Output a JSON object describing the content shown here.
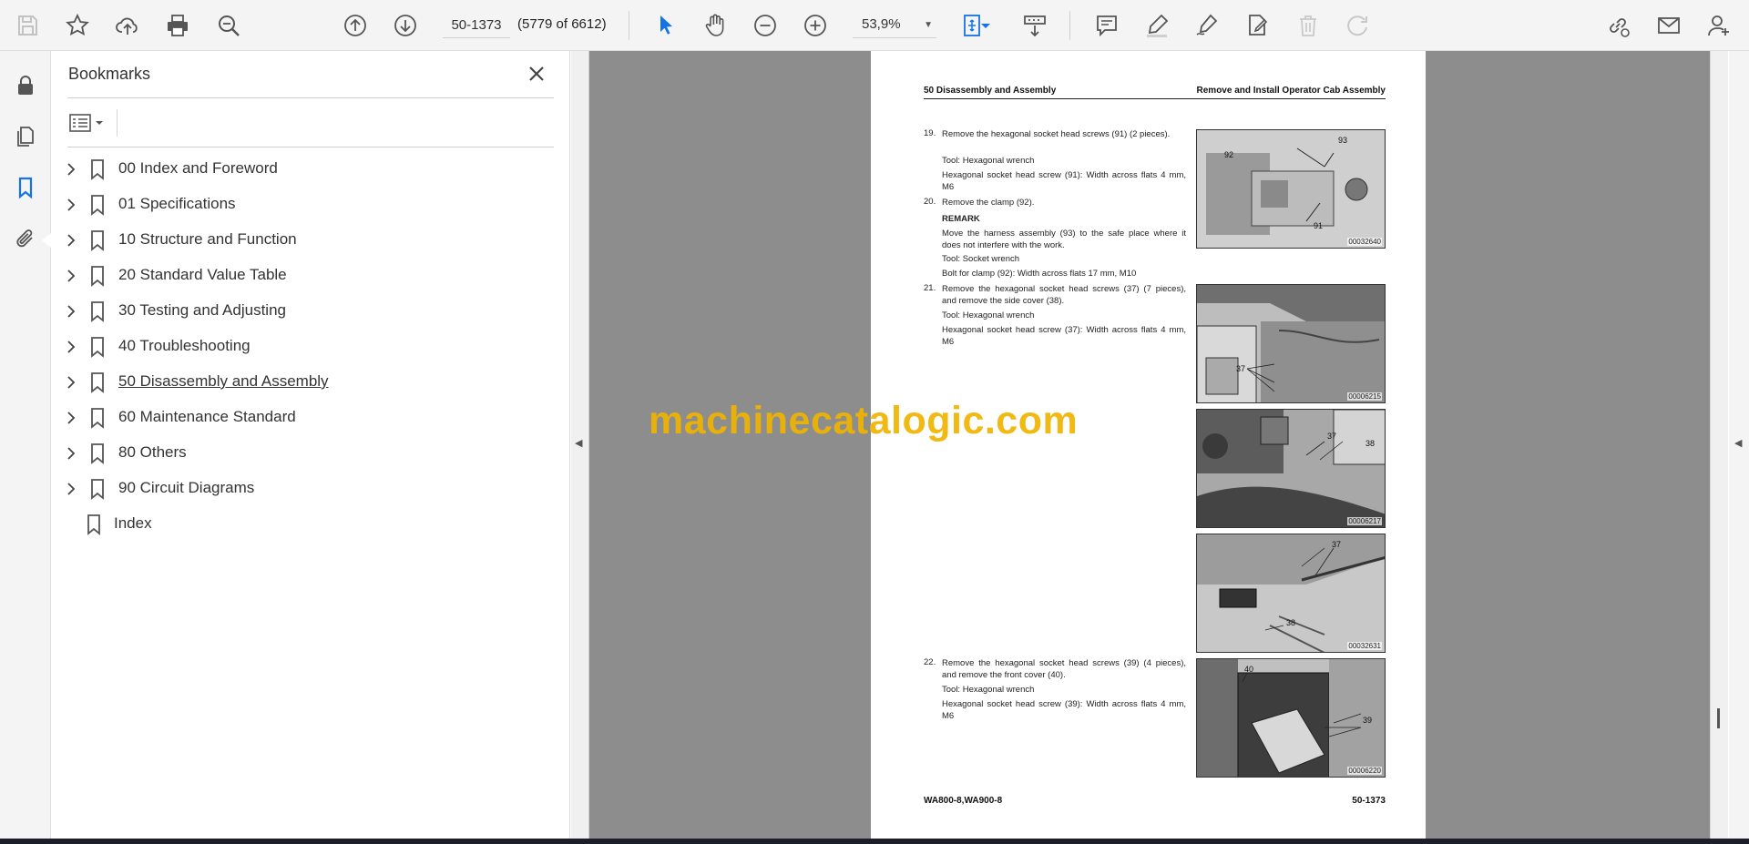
{
  "toolbar": {
    "page_input": "50-1373",
    "page_count": "(5779 of 6612)",
    "zoom": "53,9%"
  },
  "colors": {
    "accent": "#1473e6",
    "watermark": "#f0b400",
    "viewport_bg": "#8d8d8d"
  },
  "panel": {
    "title": "Bookmarks",
    "bookmarks": [
      {
        "label": "00 Index and Foreword",
        "has_children": true
      },
      {
        "label": "01 Specifications",
        "has_children": true
      },
      {
        "label": "10 Structure and Function",
        "has_children": true
      },
      {
        "label": "20 Standard Value Table",
        "has_children": true
      },
      {
        "label": "30 Testing and Adjusting",
        "has_children": true
      },
      {
        "label": "40 Troubleshooting",
        "has_children": true
      },
      {
        "label": "50 Disassembly and Assembly",
        "has_children": true
      },
      {
        "label": "60 Maintenance Standard",
        "has_children": true
      },
      {
        "label": "80 Others",
        "has_children": true
      },
      {
        "label": "90 Circuit Diagrams",
        "has_children": true
      },
      {
        "label": "Index",
        "has_children": false
      }
    ]
  },
  "document": {
    "header_left": "50 Disassembly and Assembly",
    "header_right": "Remove and Install Operator Cab Assembly",
    "steps": {
      "s19_num": "19.",
      "s19_text": "Remove the hexagonal socket head screws (91) (2 pieces).",
      "s19_tool": "Tool: Hexagonal wrench",
      "s19_spec": "Hexagonal socket head screw (91): Width across flats 4 mm, M6",
      "s20_num": "20.",
      "s20_text": "Remove the clamp (92).",
      "s20_remark_title": "REMARK",
      "s20_remark": "Move the harness assembly (93) to the safe place where it does not interfere with the work.",
      "s20_tool": "Tool: Socket wrench",
      "s20_spec": "Bolt for clamp (92): Width across flats 17 mm, M10",
      "s21_num": "21.",
      "s21_text": "Remove the hexagonal socket head screws (37) (7 pieces), and remove the side cover (38).",
      "s21_tool": "Tool: Hexagonal wrench",
      "s21_spec": "Hexagonal socket head screw (37): Width across flats 4 mm, M6",
      "s22_num": "22.",
      "s22_text": "Remove the hexagonal socket head screws (39) (4 pieces), and remove the front cover (40).",
      "s22_tool": "Tool: Hexagonal wrench",
      "s22_spec": "Hexagonal socket head screw (39): Width across flats 4 mm, M6"
    },
    "figures": [
      {
        "code": "00032640",
        "callouts": [
          "92",
          "93",
          "91"
        ]
      },
      {
        "code": "00006215",
        "callouts": [
          "37"
        ]
      },
      {
        "code": "00006217",
        "callouts": [
          "37",
          "38"
        ]
      },
      {
        "code": "00032631",
        "callouts": [
          "37",
          "38"
        ]
      },
      {
        "code": "00006220",
        "callouts": [
          "40",
          "39"
        ]
      }
    ],
    "footer_left": "WA800-8,WA900-8",
    "footer_right": "50-1373"
  },
  "watermark": "machinecatalogic.com"
}
